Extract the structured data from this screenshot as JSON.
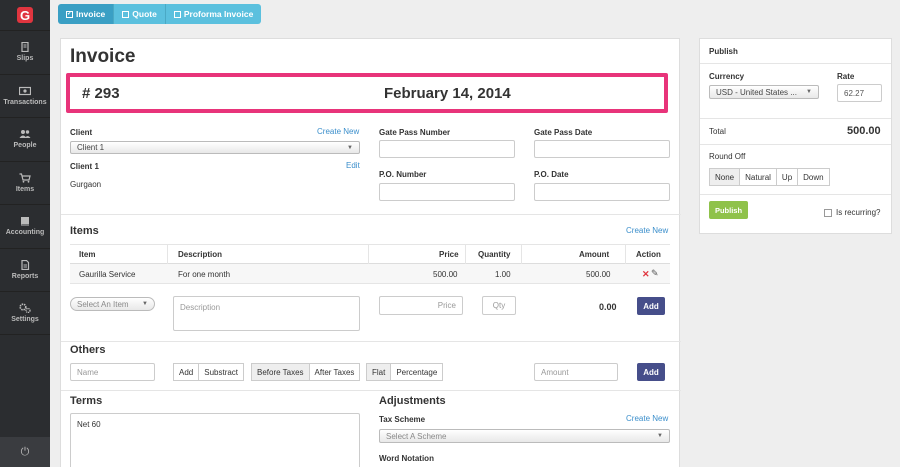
{
  "sidebar": {
    "logo": "G",
    "items": [
      {
        "label": "Slips",
        "icon": "slips-icon"
      },
      {
        "label": "Transactions",
        "icon": "transactions-icon"
      },
      {
        "label": "People",
        "icon": "people-icon"
      },
      {
        "label": "Items",
        "icon": "cart-icon"
      },
      {
        "label": "Accounting",
        "icon": "book-icon"
      },
      {
        "label": "Reports",
        "icon": "report-icon"
      },
      {
        "label": "Settings",
        "icon": "gears-icon"
      }
    ],
    "power_glyph": "⏻"
  },
  "doc_tabs": [
    {
      "label": "Invoice",
      "active": true,
      "check": "✓"
    },
    {
      "label": "Quote",
      "active": false,
      "check": ""
    },
    {
      "label": "Proforma Invoice",
      "active": false,
      "check": ""
    }
  ],
  "invoice": {
    "title": "Invoice",
    "number": "#  293",
    "date": "February 14, 2014"
  },
  "client": {
    "label": "Client",
    "create_new": "Create New",
    "selected": "Client 1",
    "name": "Client 1",
    "edit": "Edit",
    "address": "Gurgaon"
  },
  "fields": {
    "gate_pass_number": "Gate Pass Number",
    "gate_pass_date": "Gate Pass Date",
    "po_number": "P.O. Number",
    "po_date": "P.O. Date"
  },
  "items": {
    "title": "Items",
    "create_new": "Create New",
    "headers": [
      "Item",
      "Description",
      "Price",
      "Quantity",
      "Amount",
      "Action"
    ],
    "rows": [
      {
        "item": "Gaurilla Service",
        "description": "For one month",
        "price": "500.00",
        "quantity": "1.00",
        "amount": "500.00"
      }
    ],
    "delete_glyph": "✕",
    "edit_glyph": "✎",
    "new_item_placeholder": "Select An Item",
    "description_placeholder": "Description",
    "price_placeholder": "Price",
    "qty_placeholder": "Qty",
    "new_amount": "0.00",
    "add_label": "Add"
  },
  "others": {
    "title": "Others",
    "name_placeholder": "Name",
    "type_buttons": [
      "Add",
      "Substract"
    ],
    "timing_buttons": [
      "Before Taxes",
      "After Taxes"
    ],
    "mode_buttons": [
      "Flat",
      "Percentage"
    ],
    "amount_placeholder": "Amount",
    "add_label": "Add"
  },
  "terms": {
    "title": "Terms",
    "value": "Net 60"
  },
  "adjustments": {
    "title": "Adjustments",
    "tax_scheme_label": "Tax Scheme",
    "create_new": "Create New",
    "tax_scheme_placeholder": "Select A Scheme",
    "word_notation": "Word Notation"
  },
  "publish": {
    "title": "Publish",
    "currency_label": "Currency",
    "currency_value": "USD - United States ...",
    "rate_label": "Rate",
    "rate_value": "62.27",
    "total_label": "Total",
    "total_value": "500.00",
    "round_off_label": "Round Off",
    "round_options": [
      "None",
      "Natural",
      "Up",
      "Down"
    ],
    "publish_button": "Publish",
    "recurring_label": "Is recurring?"
  },
  "colors": {
    "sidebar": "#2b2d30",
    "accent": "#5bc0de",
    "highlight": "#e8347a",
    "primary_button": "#464e8a",
    "publish_button": "#8fc24a",
    "link": "#3a8ecb"
  }
}
